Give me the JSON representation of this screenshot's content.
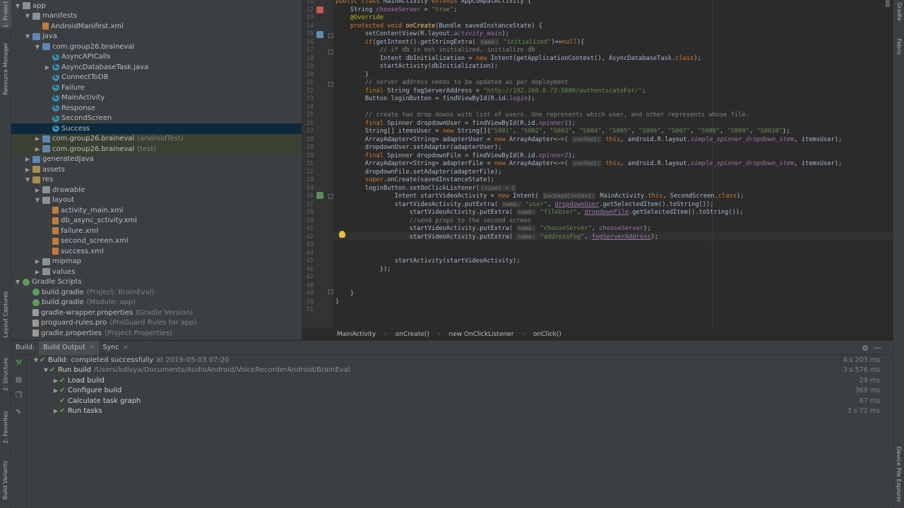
{
  "left_strip": {
    "tabs": [
      "1: Project",
      "Resource Manager",
      "Layout Captures",
      "2: Structure",
      "2: Favorites",
      "Build Variants"
    ]
  },
  "right_strip": {
    "tabs": [
      "Gradle",
      "Fabric",
      "Device File Explorer"
    ]
  },
  "project_tree": [
    {
      "label": "app",
      "suffix": "",
      "indent": 0,
      "arrow": "▼",
      "icon": "folder"
    },
    {
      "label": "manifests",
      "suffix": "",
      "indent": 1,
      "arrow": "▼",
      "icon": "folder"
    },
    {
      "label": "AndroidManifest.xml",
      "suffix": "",
      "indent": 2,
      "arrow": "",
      "icon": "xml"
    },
    {
      "label": "java",
      "suffix": "",
      "indent": 1,
      "arrow": "▼",
      "icon": "folder"
    },
    {
      "label": "com.group26.braineval",
      "suffix": "",
      "indent": 2,
      "arrow": "▼",
      "icon": "folder"
    },
    {
      "label": "AsyncAPICalls",
      "suffix": "",
      "indent": 3,
      "arrow": "",
      "icon": "cls"
    },
    {
      "label": "AsyncDatabaseTask.java",
      "suffix": "",
      "indent": 3,
      "arrow": "▶",
      "icon": "cls"
    },
    {
      "label": "ConnectToDB",
      "suffix": "",
      "indent": 3,
      "arrow": "",
      "icon": "cls"
    },
    {
      "label": "Failure",
      "suffix": "",
      "indent": 3,
      "arrow": "",
      "icon": "cls"
    },
    {
      "label": "MainActivity",
      "suffix": "",
      "indent": 3,
      "arrow": "",
      "icon": "cls"
    },
    {
      "label": "Response",
      "suffix": "",
      "indent": 3,
      "arrow": "",
      "icon": "cls"
    },
    {
      "label": "SecondScreen",
      "suffix": "",
      "indent": 3,
      "arrow": "",
      "icon": "cls"
    },
    {
      "label": "Success",
      "suffix": "",
      "indent": 3,
      "arrow": "",
      "icon": "cls",
      "selected": true
    },
    {
      "label": "com.group26.braineval",
      "suffix": "(androidTest)",
      "indent": 2,
      "arrow": "▶",
      "icon": "folder",
      "test": true
    },
    {
      "label": "com.group26.braineval",
      "suffix": "(test)",
      "indent": 2,
      "arrow": "▶",
      "icon": "folder",
      "test": true
    },
    {
      "label": "generatedJava",
      "suffix": "",
      "indent": 1,
      "arrow": "▶",
      "icon": "folder"
    },
    {
      "label": "assets",
      "suffix": "",
      "indent": 1,
      "arrow": "▶",
      "icon": "folder"
    },
    {
      "label": "res",
      "suffix": "",
      "indent": 1,
      "arrow": "▼",
      "icon": "folder"
    },
    {
      "label": "drawable",
      "suffix": "",
      "indent": 2,
      "arrow": "▶",
      "icon": "folder"
    },
    {
      "label": "layout",
      "suffix": "",
      "indent": 2,
      "arrow": "▼",
      "icon": "folder"
    },
    {
      "label": "activity_main.xml",
      "suffix": "",
      "indent": 3,
      "arrow": "",
      "icon": "xml"
    },
    {
      "label": "db_async_sctivity.xml",
      "suffix": "",
      "indent": 3,
      "arrow": "",
      "icon": "xml"
    },
    {
      "label": "failure.xml",
      "suffix": "",
      "indent": 3,
      "arrow": "",
      "icon": "xml"
    },
    {
      "label": "second_screen.xml",
      "suffix": "",
      "indent": 3,
      "arrow": "",
      "icon": "xml"
    },
    {
      "label": "success.xml",
      "suffix": "",
      "indent": 3,
      "arrow": "",
      "icon": "xml"
    },
    {
      "label": "mipmap",
      "suffix": "",
      "indent": 2,
      "arrow": "▶",
      "icon": "folder"
    },
    {
      "label": "values",
      "suffix": "",
      "indent": 2,
      "arrow": "▶",
      "icon": "folder"
    },
    {
      "label": "Gradle Scripts",
      "suffix": "",
      "indent": 0,
      "arrow": "▼",
      "icon": "gradle"
    },
    {
      "label": "build.gradle",
      "suffix": "(Project: BrainEval)",
      "indent": 1,
      "arrow": "",
      "icon": "gradle"
    },
    {
      "label": "build.gradle",
      "suffix": "(Module: app)",
      "indent": 1,
      "arrow": "",
      "icon": "gradle"
    },
    {
      "label": "gradle-wrapper.properties",
      "suffix": "(Gradle Version)",
      "indent": 1,
      "arrow": "",
      "icon": "prop"
    },
    {
      "label": "proguard-rules.pro",
      "suffix": "(ProGuard Rules for app)",
      "indent": 1,
      "arrow": "",
      "icon": "prop"
    },
    {
      "label": "gradle.properties",
      "suffix": "(Project Properties)",
      "indent": 1,
      "arrow": "",
      "icon": "prop"
    }
  ],
  "editor": {
    "lines": [
      {
        "n": "11",
        "html": "<span class='kw'>public class </span>MainActivity <span class='kw'>extends </span>AppCompatActivity {"
      },
      {
        "n": "12",
        "html": "    String <span class='fld'>chooseServer</span> = <span class='str'>\"true\"</span>;"
      },
      {
        "n": "13",
        "html": "    <span class='ann'>@Override</span>"
      },
      {
        "n": "14",
        "html": "    <span class='kw'>protected void </span><span class='fn'>onCreate</span>(Bundle savedInstanceState) {"
      },
      {
        "n": "15",
        "html": "        setContentView(R.layout.<span class='ital'>activity_main</span>);"
      },
      {
        "n": "16",
        "html": "        <span class='kw'>if</span>(getIntent().getStringExtra( <span class='hint'>name:</span> <span class='str'>\"initialized\"</span>)==<span class='kw'>null</span>){"
      },
      {
        "n": "17",
        "html": "            <span class='cm'>// if db is not initialized, initialize db</span>"
      },
      {
        "n": "18",
        "html": "            Intent dbInitialization = <span class='kw'>new </span>Intent(getApplicationContext(), AsyncDatabaseTask.<span class='kw'>class</span>);"
      },
      {
        "n": "19",
        "html": "            startActivity(dbInitialization);"
      },
      {
        "n": "20",
        "html": "        }"
      },
      {
        "n": "21",
        "html": "        <span class='cm'>// server address needs to be updated as per deployment</span>"
      },
      {
        "n": "22",
        "html": "        <span class='kw'>final </span>String fogServerAddress = <span class='str'>\"http://192.168.0.73:5000/authenticateFor/\"</span>;"
      },
      {
        "n": "23",
        "html": "        Button loginButton = findViewById(R.id.<span class='ital'>login</span>);"
      },
      {
        "n": "24",
        "html": ""
      },
      {
        "n": "25",
        "html": "        <span class='cm'>// create two drop downs with list of users. One represents which user, and other represents whose file.</span>"
      },
      {
        "n": "26",
        "html": "        <span class='kw'>final </span>Spinner dropdownUser = findViewById(R.id.<span class='ital'>spinner1</span>);"
      },
      {
        "n": "27",
        "html": "        String[] itemsUser = <span class='kw'>new </span>String[]{<span class='str'>\"S001\"</span>, <span class='str'>\"S002\"</span>, <span class='str'>\"S003\"</span>, <span class='str'>\"S004\"</span>, <span class='str'>\"S005\"</span>, <span class='str'>\"S006\"</span>, <span class='str'>\"S007\"</span>, <span class='str'>\"S008\"</span>, <span class='str'>\"S009\"</span>, <span class='str'>\"S0010\"</span>};"
      },
      {
        "n": "28",
        "html": "        ArrayAdapter&lt;String&gt; adapterUser = <span class='kw'>new </span>ArrayAdapter&lt;~&gt;( <span class='hint'>context:</span> <span class='kw'>this</span>, android.R.layout.<span class='ital'>simple_spinner_dropdown_item</span>, itemsUser);"
      },
      {
        "n": "29",
        "html": "        dropdownUser.setAdapter(adapterUser);"
      },
      {
        "n": "30",
        "html": "        <span class='kw'>final </span>Spinner dropdownFile = findViewById(R.id.<span class='ital'>spinner2</span>);"
      },
      {
        "n": "31",
        "html": "        ArrayAdapter&lt;String&gt; adapterFile = <span class='kw'>new </span>ArrayAdapter&lt;~&gt;( <span class='hint'>context:</span> <span class='kw'>this</span>, android.R.layout.<span class='ital'>simple_spinner_dropdown_item</span>, itemsUser);"
      },
      {
        "n": "32",
        "html": "        dropdownFile.setAdapter(adapterFile);"
      },
      {
        "n": "33",
        "html": "        <span class='kw'>super</span>.onCreate(savedInstanceState);"
      },
      {
        "n": "34",
        "html": "        loginButton.setOnClickListener(<span class='hint'>(view) → {</span>"
      },
      {
        "n": "36",
        "html": "                Intent startVideoActivity = <span class='kw'>new </span>Intent( <span class='hint'>packageContext:</span> MainActivity.<span class='kw'>this</span>, SecondScreen.<span class='kw'>class</span>);"
      },
      {
        "n": "37",
        "html": "                startVideoActivity.putExtra( <span class='hint'>name:</span> <span class='str'>\"user\"</span>, <span class='ul'>dropdownUser</span>.getSelectedItem().toString());"
      },
      {
        "n": "38",
        "html": "                    startVideoActivity.putExtra( <span class='hint'>name:</span> <span class='str'>\"fileUser\"</span>, <span class='ul'>dropdownFile</span>.getSelectedItem().toString());"
      },
      {
        "n": "39",
        "html": "                    <span class='cm'>//send props to the second screen</span>"
      },
      {
        "n": "41",
        "html": "                    startVideoActivity.putExtra( <span class='hint'>name:</span> <span class='str'>\"chooseServer\"</span>, <span class='fld'>chooseServer</span>);"
      },
      {
        "n": "42",
        "html": "                    startVideoActivity.putExtra( <span class='hint'>name:</span> <span class='str'>\"addressFog\"</span>, <span class='ul'>fogServerAddress</span>);"
      },
      {
        "n": "43",
        "html": ""
      },
      {
        "n": "44",
        "html": ""
      },
      {
        "n": "45",
        "html": "                startActivity(startVideoActivity);"
      },
      {
        "n": "46",
        "html": "            });"
      },
      {
        "n": "47",
        "html": ""
      },
      {
        "n": "48",
        "html": ""
      },
      {
        "n": "49",
        "html": "    }"
      },
      {
        "n": "50",
        "html": "}"
      },
      {
        "n": "51",
        "html": ""
      }
    ]
  },
  "breadcrumb": [
    "MainActivity",
    "onCreate()",
    "new OnClickListener",
    "onClick()"
  ],
  "build": {
    "tabs": {
      "build": "Build:",
      "output": "Build Output",
      "sync": "Sync"
    },
    "rows": [
      {
        "label": "Build:",
        "detail": "completed successfully",
        "muted": "at 2019-05-03 07:20",
        "time": "4 s 203 ms",
        "indent": 0,
        "arrow": "▼"
      },
      {
        "label": "Run build",
        "detail": "",
        "muted": "/Users/kdivya/Documents/AudioAndroid/VoiceRecorderAndroid/BrainEval",
        "time": "3 s 576 ms",
        "indent": 1,
        "arrow": "▼"
      },
      {
        "label": "Load build",
        "detail": "",
        "muted": "",
        "time": "29 ms",
        "indent": 2,
        "arrow": "▶"
      },
      {
        "label": "Configure build",
        "detail": "",
        "muted": "",
        "time": "369 ms",
        "indent": 2,
        "arrow": "▶"
      },
      {
        "label": "Calculate task graph",
        "detail": "",
        "muted": "",
        "time": "67 ms",
        "indent": 2,
        "arrow": ""
      },
      {
        "label": "Run tasks",
        "detail": "",
        "muted": "",
        "time": "3 s 72 ms",
        "indent": 2,
        "arrow": "▶"
      }
    ]
  }
}
